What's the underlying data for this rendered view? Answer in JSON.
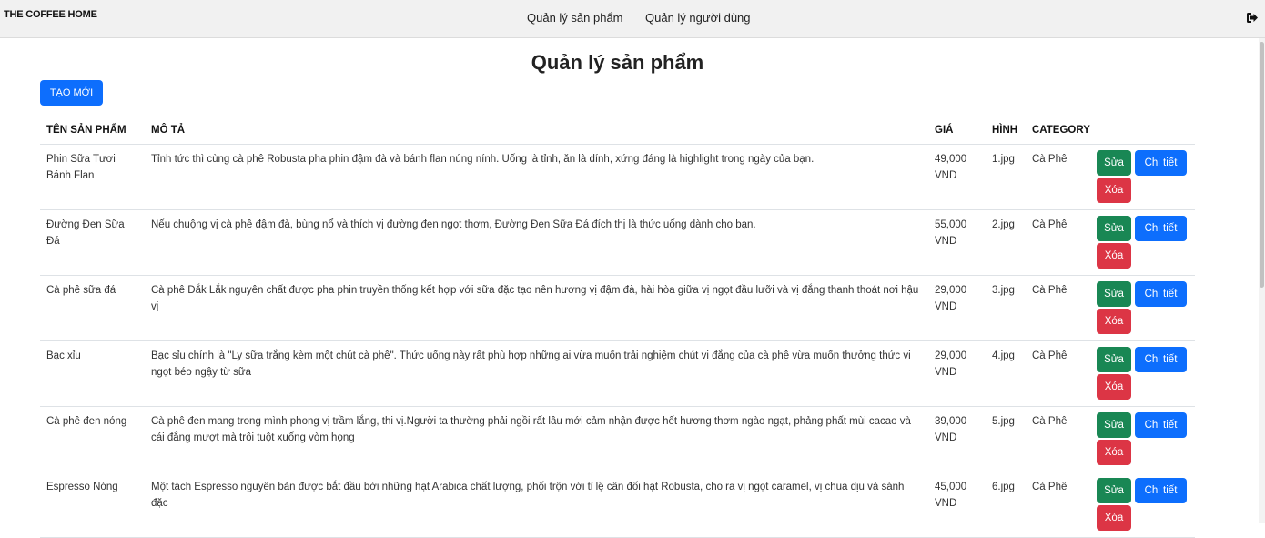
{
  "brand": "THE COFFEE HOME",
  "nav": {
    "products": "Quản lý sản phẩm",
    "users": "Quản lý người dùng",
    "logout_icon": "sign-out-icon"
  },
  "page": {
    "title": "Quản lý sản phẩm",
    "create_label": "TẠO MỚI"
  },
  "table": {
    "headers": {
      "name": "TÊN SẢN PHẨM",
      "description": "MÔ TẢ",
      "price": "GIÁ",
      "image": "HÌNH",
      "category": "CATEGORY"
    },
    "actions": {
      "edit": "Sửa",
      "detail": "Chi tiết",
      "delete": "Xóa"
    },
    "rows": [
      {
        "name": "Phin Sữa Tươi Bánh Flan",
        "description": "Tỉnh tức thì cùng cà phê Robusta pha phin đậm đà và bánh flan núng nính. Uống là tỉnh, ăn là dính, xứng đáng là highlight trong ngày của bạn.",
        "price": "49,000 VND",
        "image": "1.jpg",
        "category": "Cà Phê"
      },
      {
        "name": "Đường Đen Sữa Đá",
        "description": "Nếu chuộng vị cà phê đậm đà, bùng nổ và thích vị đường đen ngọt thơm, Đường Đen Sữa Đá đích thị là thức uống dành cho bạn.",
        "price": "55,000 VND",
        "image": "2.jpg",
        "category": "Cà Phê"
      },
      {
        "name": "Cà phê sữa đá",
        "description": "Cà phê Đắk Lắk nguyên chất được pha phin truyền thống kết hợp với sữa đặc tạo nên hương vị đậm đà, hài hòa giữa vị ngọt đầu lưỡi và vị đắng thanh thoát nơi hậu vị",
        "price": "29,000 VND",
        "image": "3.jpg",
        "category": "Cà Phê"
      },
      {
        "name": "Bạc xỉu",
        "description": "Bạc sỉu chính là \"Ly sữa trắng kèm một chút cà phê\". Thức uống này rất phù hợp những ai vừa muốn trải nghiệm chút vị đắng của cà phê vừa muốn thưởng thức vị ngọt béo ngậy từ sữa",
        "price": "29,000 VND",
        "image": "4.jpg",
        "category": "Cà Phê"
      },
      {
        "name": "Cà phê đen nóng",
        "description": "Cà phê đen mang trong mình phong vị trầm lắng, thi vị.Người ta thường phải ngồi rất lâu mới cảm nhận được hết hương thơm ngào ngạt, phảng phất mùi cacao và cái đắng mượt mà trôi tuột xuống vòm họng",
        "price": "39,000 VND",
        "image": "5.jpg",
        "category": "Cà Phê"
      },
      {
        "name": "Espresso Nóng",
        "description": "Một tách Espresso nguyên bản được bắt đầu bởi những hạt Arabica chất lượng, phối trộn với tỉ lệ cân đối hạt Robusta, cho ra vị ngọt caramel, vị chua dịu và sánh đặc",
        "price": "45,000 VND",
        "image": "6.jpg",
        "category": "Cà Phê"
      }
    ]
  }
}
